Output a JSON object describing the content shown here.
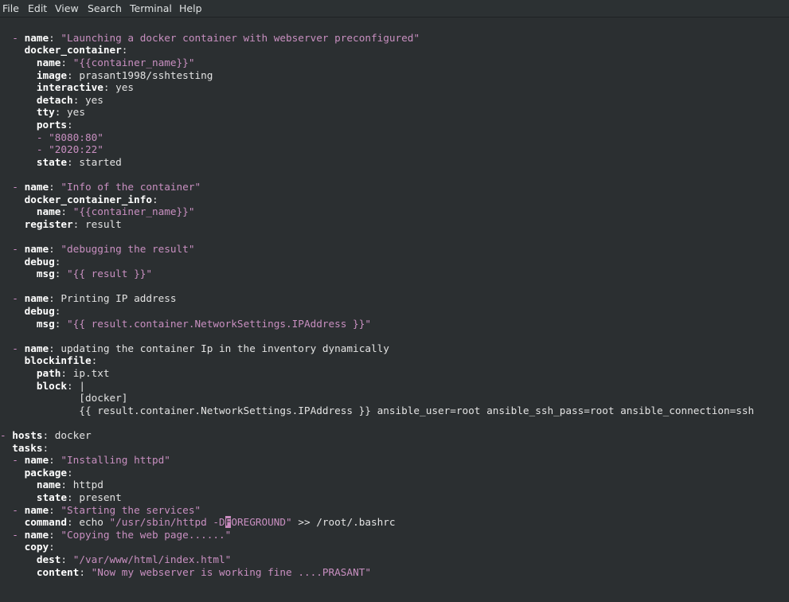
{
  "menu": [
    "File",
    "Edit",
    "View",
    "Search",
    "Terminal",
    "Help"
  ],
  "lines": [
    {
      "y": 47.5,
      "segs": [
        [
          "d",
          "  - "
        ],
        [
          "k",
          "name"
        ],
        [
          "p",
          ": "
        ],
        [
          "s",
          "\"Launching a docker container with webserver preconfigured\""
        ]
      ]
    },
    {
      "y": 63.1,
      "segs": [
        [
          "v",
          "    "
        ],
        [
          "k",
          "docker_container"
        ],
        [
          "p",
          ":"
        ]
      ]
    },
    {
      "y": 78.7,
      "segs": [
        [
          "v",
          "      "
        ],
        [
          "k",
          "name"
        ],
        [
          "p",
          ": "
        ],
        [
          "s",
          "\"{{container_name}}\""
        ]
      ]
    },
    {
      "y": 94.3,
      "segs": [
        [
          "v",
          "      "
        ],
        [
          "k",
          "image"
        ],
        [
          "p",
          ": "
        ],
        [
          "v",
          "prasant1998/sshtesting"
        ]
      ]
    },
    {
      "y": 109.9,
      "segs": [
        [
          "v",
          "      "
        ],
        [
          "k",
          "interactive"
        ],
        [
          "p",
          ": "
        ],
        [
          "v",
          "yes"
        ]
      ]
    },
    {
      "y": 125.5,
      "segs": [
        [
          "v",
          "      "
        ],
        [
          "k",
          "detach"
        ],
        [
          "p",
          ": "
        ],
        [
          "v",
          "yes"
        ]
      ]
    },
    {
      "y": 141.1,
      "segs": [
        [
          "v",
          "      "
        ],
        [
          "k",
          "tty"
        ],
        [
          "p",
          ": "
        ],
        [
          "v",
          "yes"
        ]
      ]
    },
    {
      "y": 156.7,
      "segs": [
        [
          "v",
          "      "
        ],
        [
          "k",
          "ports"
        ],
        [
          "p",
          ":"
        ]
      ]
    },
    {
      "y": 172.3,
      "segs": [
        [
          "d",
          "      - "
        ],
        [
          "s",
          "\"8080:80\""
        ]
      ]
    },
    {
      "y": 187.9,
      "segs": [
        [
          "d",
          "      - "
        ],
        [
          "s",
          "\"2020:22\""
        ]
      ]
    },
    {
      "y": 203.5,
      "segs": [
        [
          "v",
          "      "
        ],
        [
          "k",
          "state"
        ],
        [
          "p",
          ": "
        ],
        [
          "v",
          "started"
        ]
      ]
    },
    {
      "y": 234.7,
      "segs": [
        [
          "d",
          "  - "
        ],
        [
          "k",
          "name"
        ],
        [
          "p",
          ": "
        ],
        [
          "s",
          "\"Info of the container\""
        ]
      ]
    },
    {
      "y": 250.3,
      "segs": [
        [
          "v",
          "    "
        ],
        [
          "k",
          "docker_container_info"
        ],
        [
          "p",
          ":"
        ]
      ]
    },
    {
      "y": 265.9,
      "segs": [
        [
          "v",
          "      "
        ],
        [
          "k",
          "name"
        ],
        [
          "p",
          ": "
        ],
        [
          "s",
          "\"{{container_name}}\""
        ]
      ]
    },
    {
      "y": 281.5,
      "segs": [
        [
          "v",
          "    "
        ],
        [
          "k",
          "register"
        ],
        [
          "p",
          ": "
        ],
        [
          "v",
          "result"
        ]
      ]
    },
    {
      "y": 312.7,
      "segs": [
        [
          "d",
          "  - "
        ],
        [
          "k",
          "name"
        ],
        [
          "p",
          ": "
        ],
        [
          "s",
          "\"debugging the result\""
        ]
      ]
    },
    {
      "y": 328.3,
      "segs": [
        [
          "v",
          "    "
        ],
        [
          "k",
          "debug"
        ],
        [
          "p",
          ":"
        ]
      ]
    },
    {
      "y": 343.9,
      "segs": [
        [
          "v",
          "      "
        ],
        [
          "k",
          "msg"
        ],
        [
          "p",
          ": "
        ],
        [
          "s",
          "\"{{ result }}\""
        ]
      ]
    },
    {
      "y": 375.1,
      "segs": [
        [
          "d",
          "  - "
        ],
        [
          "k",
          "name"
        ],
        [
          "p",
          ": "
        ],
        [
          "v",
          "Printing IP address"
        ]
      ]
    },
    {
      "y": 390.7,
      "segs": [
        [
          "v",
          "    "
        ],
        [
          "k",
          "debug"
        ],
        [
          "p",
          ":"
        ]
      ]
    },
    {
      "y": 406.3,
      "segs": [
        [
          "v",
          "      "
        ],
        [
          "k",
          "msg"
        ],
        [
          "p",
          ": "
        ],
        [
          "s",
          "\"{{ result.container.NetworkSettings.IPAddress }}\""
        ]
      ]
    },
    {
      "y": 437.5,
      "segs": [
        [
          "d",
          "  - "
        ],
        [
          "k",
          "name"
        ],
        [
          "p",
          ": "
        ],
        [
          "v",
          "updating the container Ip in the inventory dynamically"
        ]
      ]
    },
    {
      "y": 453.1,
      "segs": [
        [
          "v",
          "    "
        ],
        [
          "k",
          "blockinfile"
        ],
        [
          "p",
          ":"
        ]
      ]
    },
    {
      "y": 468.7,
      "segs": [
        [
          "v",
          "      "
        ],
        [
          "k",
          "path"
        ],
        [
          "p",
          ": "
        ],
        [
          "v",
          "ip.txt"
        ]
      ]
    },
    {
      "y": 484.3,
      "segs": [
        [
          "v",
          "      "
        ],
        [
          "k",
          "block"
        ],
        [
          "p",
          ": "
        ],
        [
          "v",
          "|"
        ]
      ]
    },
    {
      "y": 499.9,
      "segs": [
        [
          "v",
          "             [docker]"
        ]
      ]
    },
    {
      "y": 515.5,
      "segs": [
        [
          "v",
          "             {{ result.container.NetworkSettings.IPAddress }} ansible_user=root ansible_ssh_pass=root ansible_connection=ssh"
        ]
      ]
    },
    {
      "y": 546.7,
      "segs": [
        [
          "d",
          "- "
        ],
        [
          "k",
          "hosts"
        ],
        [
          "p",
          ": "
        ],
        [
          "v",
          "docker"
        ]
      ]
    },
    {
      "y": 562.3,
      "segs": [
        [
          "v",
          "  "
        ],
        [
          "k",
          "tasks"
        ],
        [
          "p",
          ":"
        ]
      ]
    },
    {
      "y": 577.9,
      "segs": [
        [
          "d",
          "  - "
        ],
        [
          "k",
          "name"
        ],
        [
          "p",
          ": "
        ],
        [
          "s",
          "\"Installing httpd\""
        ]
      ]
    },
    {
      "y": 593.5,
      "segs": [
        [
          "v",
          "    "
        ],
        [
          "k",
          "package"
        ],
        [
          "p",
          ":"
        ]
      ]
    },
    {
      "y": 609.1,
      "segs": [
        [
          "v",
          "      "
        ],
        [
          "k",
          "name"
        ],
        [
          "p",
          ": "
        ],
        [
          "v",
          "httpd"
        ]
      ]
    },
    {
      "y": 624.7,
      "segs": [
        [
          "v",
          "      "
        ],
        [
          "k",
          "state"
        ],
        [
          "p",
          ": "
        ],
        [
          "v",
          "present"
        ]
      ]
    },
    {
      "y": 640.3,
      "segs": [
        [
          "d",
          "  - "
        ],
        [
          "k",
          "name"
        ],
        [
          "p",
          ": "
        ],
        [
          "s",
          "\"Starting the services\""
        ]
      ]
    },
    {
      "y": 655.9,
      "segs": [
        [
          "v",
          "    "
        ],
        [
          "k",
          "command"
        ],
        [
          "p",
          ": "
        ],
        [
          "v",
          "echo "
        ],
        [
          "s",
          "\"/usr/sbin/httpd -D"
        ],
        [
          "c",
          "F"
        ],
        [
          "s",
          "OREGROUND\""
        ],
        [
          "v",
          " >> /root/.bashrc"
        ]
      ]
    },
    {
      "y": 671.5,
      "segs": [
        [
          "d",
          "  - "
        ],
        [
          "k",
          "name"
        ],
        [
          "p",
          ": "
        ],
        [
          "s",
          "\"Copying the web page......\""
        ]
      ]
    },
    {
      "y": 687.1,
      "segs": [
        [
          "v",
          "    "
        ],
        [
          "k",
          "copy"
        ],
        [
          "p",
          ":"
        ]
      ]
    },
    {
      "y": 702.7,
      "segs": [
        [
          "v",
          "      "
        ],
        [
          "k",
          "dest"
        ],
        [
          "p",
          ": "
        ],
        [
          "s",
          "\"/var/www/html/index.html\""
        ]
      ]
    },
    {
      "y": 718.3,
      "segs": [
        [
          "v",
          "      "
        ],
        [
          "k",
          "content"
        ],
        [
          "p",
          ": "
        ],
        [
          "s",
          "\"Now my webserver is working fine ....PRASANT\""
        ]
      ]
    }
  ],
  "colors": {
    "background": "#2b2f31",
    "key": "#ffffff",
    "string": "#c88fc0",
    "dash": "#cf8fc6",
    "cursor": "#c98bbf"
  }
}
